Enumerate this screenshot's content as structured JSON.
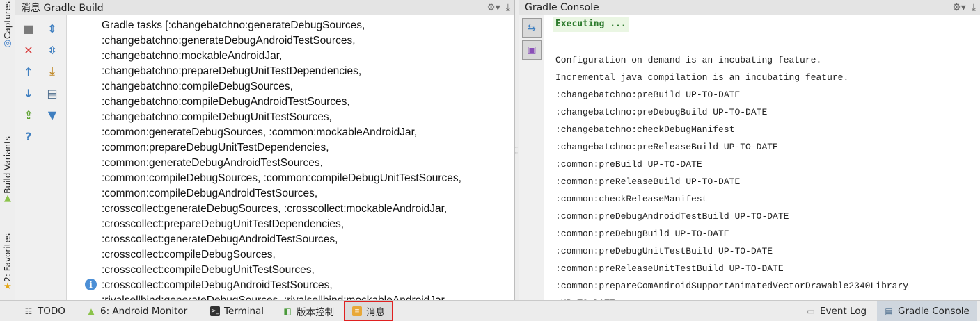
{
  "left_strip": {
    "captures": "Captures",
    "build_variants": "Build Variants",
    "favorites": "2: Favorites"
  },
  "messages_panel": {
    "title": "消息 Gradle Build",
    "lines": [
      "Gradle tasks [:changebatchno:generateDebugSources,",
      ":changebatchno:generateDebugAndroidTestSources,",
      ":changebatchno:mockableAndroidJar,",
      ":changebatchno:prepareDebugUnitTestDependencies,",
      ":changebatchno:compileDebugSources,",
      ":changebatchno:compileDebugAndroidTestSources,",
      ":changebatchno:compileDebugUnitTestSources,",
      ":common:generateDebugSources, :common:mockableAndroidJar,",
      ":common:prepareDebugUnitTestDependencies,",
      ":common:generateDebugAndroidTestSources,",
      ":common:compileDebugSources, :common:compileDebugUnitTestSources,",
      ":common:compileDebugAndroidTestSources,",
      ":crosscollect:generateDebugSources, :crosscollect:mockableAndroidJar,",
      ":crosscollect:prepareDebugUnitTestDependencies,",
      ":crosscollect:generateDebugAndroidTestSources,",
      ":crosscollect:compileDebugSources,",
      ":crosscollect:compileDebugUnitTestSources,",
      ":crosscollect:compileDebugAndroidTestSources,",
      ":rivalsellbind:generateDebugSources, :rivalsellbind:mockableAndroidJar,"
    ]
  },
  "console_panel": {
    "title": "Gradle Console",
    "executing": "Executing ...",
    "lines": [
      "Configuration on demand is an incubating feature.",
      "Incremental java compilation is an incubating feature.",
      ":changebatchno:preBuild UP-TO-DATE",
      ":changebatchno:preDebugBuild UP-TO-DATE",
      ":changebatchno:checkDebugManifest",
      ":changebatchno:preReleaseBuild UP-TO-DATE",
      ":common:preBuild UP-TO-DATE",
      ":common:preReleaseBuild UP-TO-DATE",
      ":common:checkReleaseManifest",
      ":common:preDebugAndroidTestBuild UP-TO-DATE",
      ":common:preDebugBuild UP-TO-DATE",
      ":common:preDebugUnitTestBuild UP-TO-DATE",
      ":common:preReleaseUnitTestBuild UP-TO-DATE",
      ":common:prepareComAndroidSupportAnimatedVectorDrawable2340Library",
      " UP-TO-DATE"
    ]
  },
  "bottom_bar": {
    "todo": "TODO",
    "android_monitor": "6: Android Monitor",
    "terminal": "Terminal",
    "version_control": "版本控制",
    "messages": "消息",
    "event_log": "Event Log",
    "gradle_console": "Gradle Console"
  },
  "icons": {
    "gear": "gear-icon",
    "pin": "pin-icon",
    "stop": "stop-icon",
    "close": "close-icon",
    "up": "arrow-up-icon",
    "down": "arrow-down-icon",
    "export": "export-icon",
    "help": "help-icon",
    "info": "info-icon"
  },
  "colors": {
    "selection_outline": "#e02020",
    "executing_bg": "#eaf6e3",
    "executing_text": "#2c7a2c",
    "info_blue": "#4c8fd6"
  }
}
